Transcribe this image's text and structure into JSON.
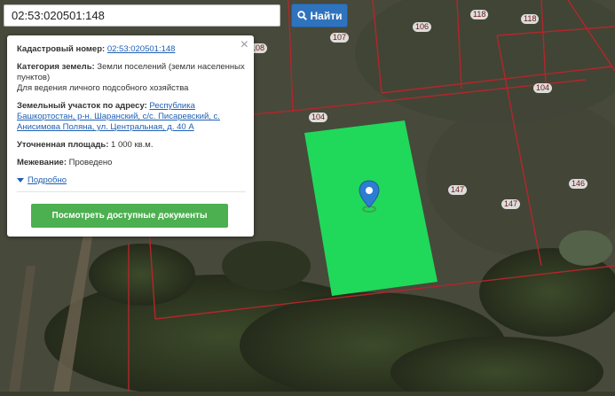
{
  "search": {
    "value": "02:53:020501:148",
    "button_label": "Найти"
  },
  "popup": {
    "cadastral_label": "Кадастровый номер:",
    "cadastral_value": "02:53:020501:148",
    "category_label": "Категория земель:",
    "category_value": "Земли поселений (земли населенных пунктов)",
    "usage_value": "Для ведения личного подсобного хозяйства",
    "address_label": "Земельный участок по адресу:",
    "address_value": "Республика Башкортостан, р-н. Шаранский, с/с. Писаревский, с. Анисимова Поляна, ул. Центральная, д. 40 А",
    "area_label": "Уточненная площадь:",
    "area_value": "1 000 кв.м.",
    "survey_label": "Межевание:",
    "survey_value": "Проведено",
    "details_label": "Подробно",
    "docs_button_label": "Посмотреть доступные документы",
    "close_glyph": "×"
  },
  "map": {
    "lot_labels": [
      "118",
      "118",
      "107",
      "106",
      "108",
      "104",
      "104",
      "147",
      "147",
      "146"
    ],
    "parcel_color": "#20d95a",
    "boundary_color": "#b3262b",
    "marker_color": "#2e7dd1"
  }
}
